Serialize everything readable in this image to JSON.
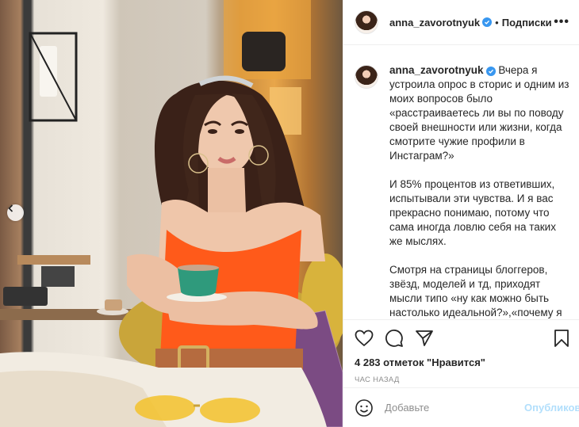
{
  "post": {
    "username": "anna_zavorotnyuk",
    "separator": "•",
    "follow_label": "Подписки",
    "more_label": "•••"
  },
  "caption": {
    "username": "anna_zavorotnyuk",
    "paragraphs": [
      "Вчера я устроила опрос в сторис и одним из моих вопросов было «расстраиваетесь ли вы по поводу своей внешности или жизни, когда смотрите чужие профили в Инстаграм?»",
      "И 85% процентов из ответивших, испытывали эти чувства. И я вас прекрасно понимаю, потому что сама иногда ловлю себя на таких же мыслях.",
      "Смотря на страницы блоггеров, звёзд, моделей и тд, приходят мысли типо «ну как можно быть настолько идеальной?»,«почему я не могу столько путешествовать?», «почему я так мало зарабатываю?» и"
    ]
  },
  "stats": {
    "likes_label": "4 283 отметок \"Нравится\"",
    "time_label": "ЧАС НАЗАД"
  },
  "comment": {
    "placeholder": "Добавьте",
    "publish_label": "Опубликовать"
  },
  "icons": {
    "like": "heart-icon",
    "comment": "comment-icon",
    "share": "share-icon",
    "save": "bookmark-icon",
    "emoji": "emoji-icon",
    "verified": "verified-icon",
    "prev": "chevron-left-icon"
  },
  "colors": {
    "verified": "#3897f0",
    "publish_disabled": "#b2dffc",
    "shirt": "#ff5a1a"
  }
}
